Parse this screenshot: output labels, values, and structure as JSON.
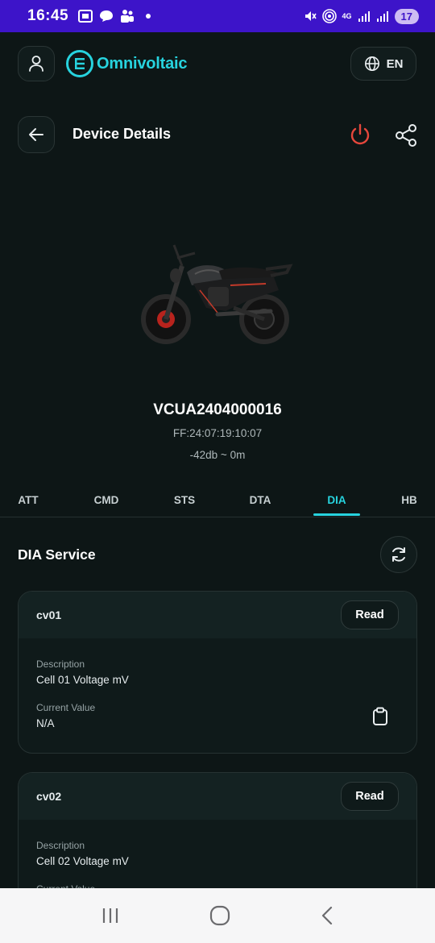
{
  "status_bar": {
    "time": "16:45",
    "battery": "17",
    "network": "4G"
  },
  "header": {
    "brand": "Omnivoltaic",
    "language": "EN"
  },
  "page": {
    "title": "Device Details"
  },
  "device": {
    "id": "VCUA2404000016",
    "mac": "FF:24:07:19:10:07",
    "signal": "-42db ~ 0m"
  },
  "tabs": [
    {
      "label": "ATT"
    },
    {
      "label": "CMD"
    },
    {
      "label": "STS"
    },
    {
      "label": "DTA"
    },
    {
      "label": "DIA"
    },
    {
      "label": "HB"
    }
  ],
  "active_tab": "DIA",
  "section": {
    "title": "DIA Service"
  },
  "cards": [
    {
      "name": "cv01",
      "read_label": "Read",
      "description_label": "Description",
      "description": "Cell 01 Voltage mV",
      "current_label": "Current Value",
      "current_value": "N/A"
    },
    {
      "name": "cv02",
      "read_label": "Read",
      "description_label": "Description",
      "description": "Cell 02 Voltage mV",
      "current_label": "Current Value"
    }
  ],
  "colors": {
    "accent": "#27d3de",
    "power": "#e5473c",
    "status_bar": "#3d14c9",
    "background": "#0d1616"
  }
}
